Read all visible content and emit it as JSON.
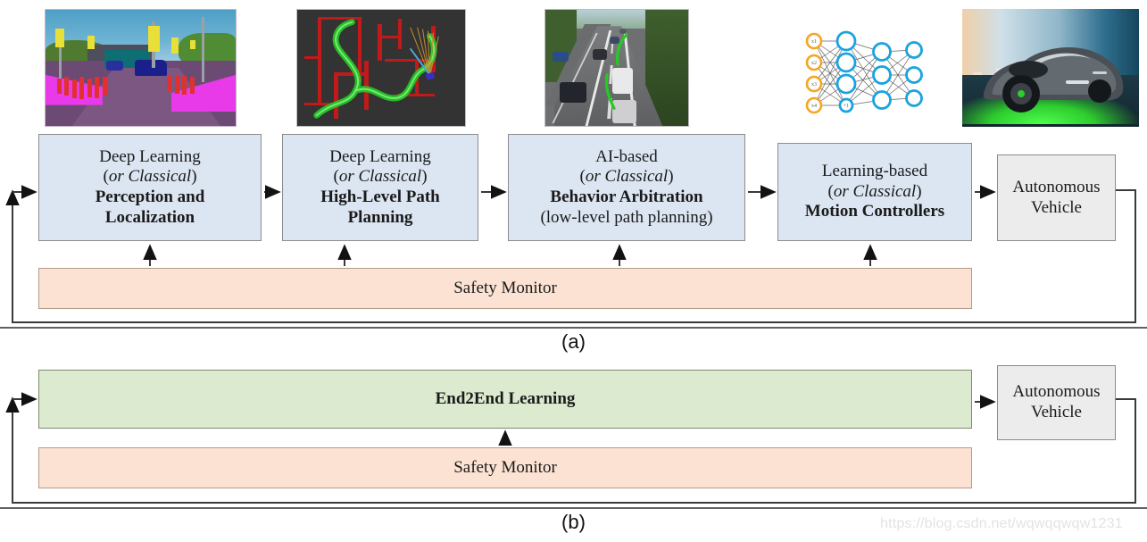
{
  "figure": {
    "watermark": "https://blog.csdn.net/wqwqqwqw1231",
    "captions": {
      "a": "(a)",
      "b": "(b)"
    },
    "colors": {
      "module_fill": "#dce6f2",
      "vehicle_fill": "#ececec",
      "end2end_fill": "#dcead0",
      "safety_fill": "#fbe2d3",
      "border": "#8c8c8c",
      "arrow": "#1a1a1a"
    }
  },
  "thumbnails": [
    {
      "name": "semantic-segmentation-image",
      "alt": "Semantic segmentation of an urban street scene"
    },
    {
      "name": "path-planning-image",
      "alt": "Green planned trajectories over a red road network map"
    },
    {
      "name": "highway-trajectory-image",
      "alt": "Highway scene with green planned lane-change trajectories"
    },
    {
      "name": "neural-network-image",
      "alt": "Fully connected neural network diagram"
    },
    {
      "name": "autonomous-vehicle-image",
      "alt": "Futuristic autonomous concept car on a highway"
    }
  ],
  "pipeline_a": {
    "modules": [
      {
        "line1": "Deep Learning",
        "line2_italic": "or Classical",
        "line3": "Perception and",
        "line4": "Localization"
      },
      {
        "line1": "Deep Learning",
        "line2_italic": "or Classical",
        "line3": "High-Level Path",
        "line4": "Planning"
      },
      {
        "line1": "AI-based",
        "line2_italic": "or Classical",
        "line3": "Behavior Arbitration",
        "line4": "(low-level path planning)"
      },
      {
        "line1": "Learning-based",
        "line2_italic": "or Classical",
        "line3": "Motion Controllers",
        "line4": ""
      }
    ],
    "vehicle": {
      "line1": "Autonomous",
      "line2": "Vehicle"
    },
    "safety_monitor": "Safety Monitor"
  },
  "pipeline_b": {
    "end2end": "End2End Learning",
    "vehicle": {
      "line1": "Autonomous",
      "line2": "Vehicle"
    },
    "safety_monitor": "Safety Monitor"
  },
  "neural_network": {
    "input_labels": [
      "x₁",
      "x₂",
      "x₃",
      "x₄"
    ],
    "layer_sizes": [
      4,
      4,
      3,
      3
    ],
    "input_color": "#f5a623",
    "hidden_color": "#19a3e0"
  }
}
